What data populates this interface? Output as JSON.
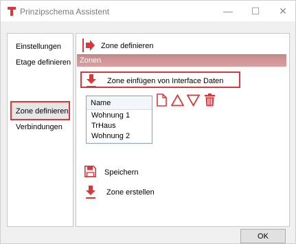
{
  "window": {
    "title": "Prinzipschema Assistent",
    "minimize": "—",
    "maximize": "☐",
    "close": "✕"
  },
  "sidebar": {
    "items": [
      {
        "label": "Einstellungen"
      },
      {
        "label": "Etage definieren"
      },
      {
        "label": "Zone definieren"
      },
      {
        "label": "Verbindungen"
      }
    ],
    "active_index": 2
  },
  "main": {
    "header": "Zone definieren",
    "section_title": "Zonen",
    "import_button": "Zone einfügen von Interface Daten",
    "table": {
      "column": "Name",
      "rows": [
        "Wohnung 1",
        "TrHaus",
        "Wohnung 2"
      ]
    },
    "save_button": "Speichern",
    "create_button": "Zone erstellen"
  },
  "footer": {
    "ok_button": "OK"
  },
  "colors": {
    "accent": "#d9383a",
    "section_bar": "#d9a1a2"
  },
  "icons": [
    "app-logo-icon",
    "arrow-right-icon",
    "arrow-down-icon",
    "new-document-icon",
    "move-up-icon",
    "move-down-icon",
    "delete-icon",
    "save-icon"
  ]
}
